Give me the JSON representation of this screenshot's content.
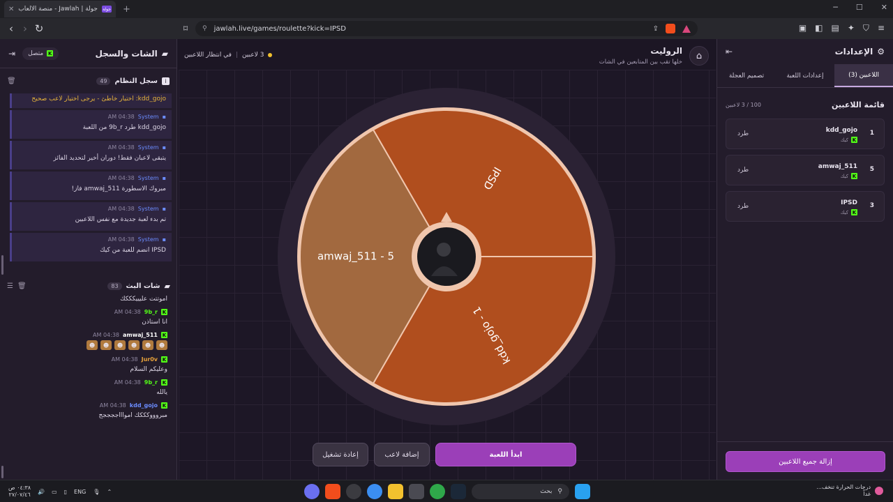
{
  "browser": {
    "tab_title": "جولة | Jawlah - منصة الألعاب التفا",
    "favicon_label": "جولة",
    "url": "jawlah.live/games/roulette?kick=IPSD"
  },
  "left_panel": {
    "title": "الشات والسجل",
    "status": "متصل",
    "system_log": {
      "title": "سجل النظام",
      "count": "49",
      "first_text": "kdd_gojo: اختيار خاطئ - يرجى اختيار لاعب صحيح",
      "items": [
        {
          "name": "System",
          "time": "04:38 AM",
          "text": "kdd_gojo طرد 9b_r من اللعبة"
        },
        {
          "name": "System",
          "time": "04:38 AM",
          "text": "يتبقى لاعبان فقط! دوران أخير لتحديد الفائز"
        },
        {
          "name": "System",
          "time": "04:38 AM",
          "text": "مبروك الاسطورة amwaj_511 فاز!"
        },
        {
          "name": "System",
          "time": "04:38 AM",
          "text": "تم بدء لعبة جديدة مع نفس اللاعبين"
        },
        {
          "name": "System",
          "time": "04:38 AM",
          "text": "IPSD انضم للعبة من كيك"
        }
      ]
    },
    "stream_chat": {
      "title": "شات البث",
      "count": "83",
      "first_text": "اموتتت عليييكككك",
      "items": [
        {
          "user": "9b_r",
          "color": "#53fc18",
          "time": "04:38 AM",
          "text": "انا استاذن",
          "emotes": false
        },
        {
          "user": "amwaj_511",
          "color": "#ffffff",
          "time": "04:38 AM",
          "text": "",
          "emotes": true
        },
        {
          "user": "Jur0v",
          "color": "#e8a23a",
          "time": "04:38 AM",
          "text": "وعليكم السلام",
          "emotes": false
        },
        {
          "user": "9b_r",
          "color": "#53fc18",
          "time": "04:38 AM",
          "text": "يالله",
          "emotes": false
        },
        {
          "user": "kdd_gojo",
          "color": "#6b8cff",
          "time": "04:38 AM",
          "text": "مبروووكككك امواااججججج",
          "emotes": false
        }
      ]
    }
  },
  "center": {
    "title": "الروليت",
    "subtitle": "خلها تقب بين المتابعين في الشات",
    "players_count": "3 لاعبين",
    "waiting": "في انتظار اللاعبين",
    "wheel": {
      "segments": [
        {
          "label": "IPSD",
          "color": "#b04e1e"
        },
        {
          "label": "kdd_gojo - 1",
          "color": "#b04e1e"
        },
        {
          "label": "amwaj_511 - 5",
          "color": "#a2693f"
        }
      ]
    },
    "buttons": {
      "start": "ابدأ اللعبة",
      "add_player": "إضافة لاعب",
      "restart": "إعادة تشغيل"
    }
  },
  "right_panel": {
    "title": "الإعدادات",
    "tabs": [
      "اللاعبين (3)",
      "إعدادات اللعبة",
      "تصميم العجلة"
    ],
    "list_title": "قائمة اللاعبين",
    "list_count": "100 / 3 لاعبين",
    "players": [
      {
        "num": "1",
        "name": "kdd_gojo",
        "platform": "كيك",
        "kick": "طرد"
      },
      {
        "num": "5",
        "name": "amwaj_511",
        "platform": "كيك",
        "kick": "طرد"
      },
      {
        "num": "3",
        "name": "IPSD",
        "platform": "كيك",
        "kick": "طرد"
      }
    ],
    "remove_all": "إزالة جميع اللاعبين"
  },
  "taskbar": {
    "time": "٠٤:٣٨ ص",
    "date": "٢٧/٠٧/٤٦",
    "lang": "ENG",
    "search": "بحث",
    "weather_line1": "درجات الحرارة تنخف...",
    "weather_line2": "غداً"
  },
  "colors": {
    "accent_purple": "#9b3fb8",
    "kick_green": "#53fc18",
    "wheel_orange": "#b04e1e",
    "wheel_tan": "#a2693f"
  }
}
